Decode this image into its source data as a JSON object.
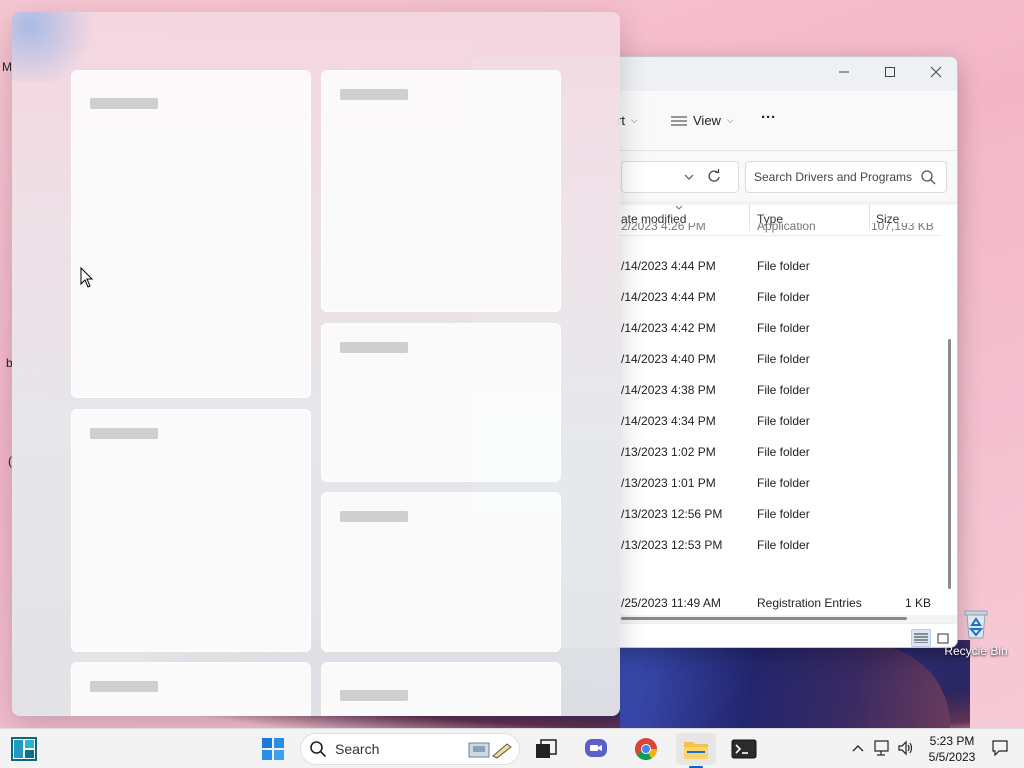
{
  "desktop": {
    "edge_glyphs": [
      "M",
      "b",
      "("
    ],
    "recycle_bin_label": "Recycle Bin",
    "icons": {
      "recycle": "recycle-bin-icon",
      "cursor": "mouse-pointer-icon"
    }
  },
  "explorer": {
    "toolbar": {
      "sort_label": "rt",
      "view_label": "View",
      "more_label": "···"
    },
    "search": {
      "placeholder": "Search Drivers and Programs"
    },
    "columns": {
      "date_modified": "ate modified",
      "type": "Type",
      "size": "Size"
    },
    "partial_row": {
      "date": "2/2023 4:26 PM",
      "type": "Application",
      "size": "107,193 KB"
    },
    "rows": [
      {
        "date": "/14/2023 4:44 PM",
        "type": "File folder",
        "size": ""
      },
      {
        "date": "/14/2023 4:44 PM",
        "type": "File folder",
        "size": ""
      },
      {
        "date": "/14/2023 4:42 PM",
        "type": "File folder",
        "size": ""
      },
      {
        "date": "/14/2023 4:40 PM",
        "type": "File folder",
        "size": ""
      },
      {
        "date": "/14/2023 4:38 PM",
        "type": "File folder",
        "size": ""
      },
      {
        "date": "/14/2023 4:34 PM",
        "type": "File folder",
        "size": ""
      },
      {
        "date": "/13/2023 1:02 PM",
        "type": "File folder",
        "size": ""
      },
      {
        "date": "/13/2023 1:01 PM",
        "type": "File folder",
        "size": ""
      },
      {
        "date": "/13/2023 12:56 PM",
        "type": "File folder",
        "size": ""
      },
      {
        "date": "/13/2023 12:53 PM",
        "type": "File folder",
        "size": ""
      }
    ],
    "last_row": {
      "date": "/25/2023 11:49 AM",
      "type": "Registration Entries",
      "size": "1 KB"
    }
  },
  "widgets": {
    "accent": "#cfcfcf"
  },
  "taskbar": {
    "search_label": "Search",
    "clock_time": "5:23 PM",
    "clock_date": "5/5/2023",
    "icons": [
      "widgets-icon",
      "start-icon",
      "search-icon",
      "task-view-icon",
      "teams-chat-icon",
      "chrome-icon",
      "file-explorer-icon",
      "terminal-icon",
      "chevron-up-icon",
      "network-icon",
      "volume-icon",
      "notifications-icon"
    ],
    "accent": "#0a64c8"
  }
}
